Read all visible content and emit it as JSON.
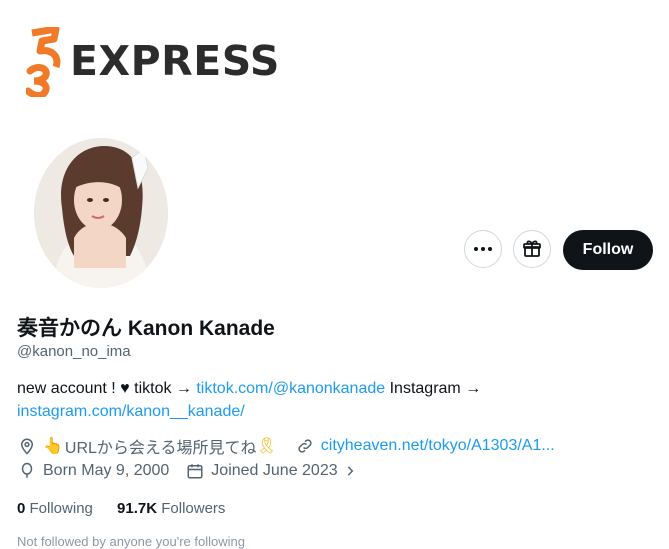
{
  "brand": {
    "logo_text": "EXPRESS",
    "logo_number_glyph": "35"
  },
  "profile": {
    "display_name": "奏音かのん Kanon Kanade",
    "handle": "@kanon_no_ima",
    "bio": {
      "text1": "new account ! ",
      "heart": "♥",
      "text2": " tiktok → ",
      "tiktok_link": "tiktok.com/@kanonkanade",
      "text3": " Instagram →",
      "instagram_link": "instagram.com/kanon__kanade/"
    },
    "location_emoji": "👆",
    "location_text": "URLから会える場所見てね",
    "ribbon_emoji": "🎗",
    "website": "cityheaven.net/tokyo/A1303/A1...",
    "birth": "Born May 9, 2000",
    "joined": "Joined June 2023"
  },
  "buttons": {
    "follow": "Follow"
  },
  "stats": {
    "following_count": "0",
    "following_label": " Following",
    "followers_count": "91.7K",
    "followers_label": " Followers"
  },
  "footer_cut": "Not followed by anyone you're following",
  "colors": {
    "accent": "#1d9bf0",
    "text": "#0f1419",
    "muted": "#536471",
    "logo_orange": "#f07a28"
  }
}
